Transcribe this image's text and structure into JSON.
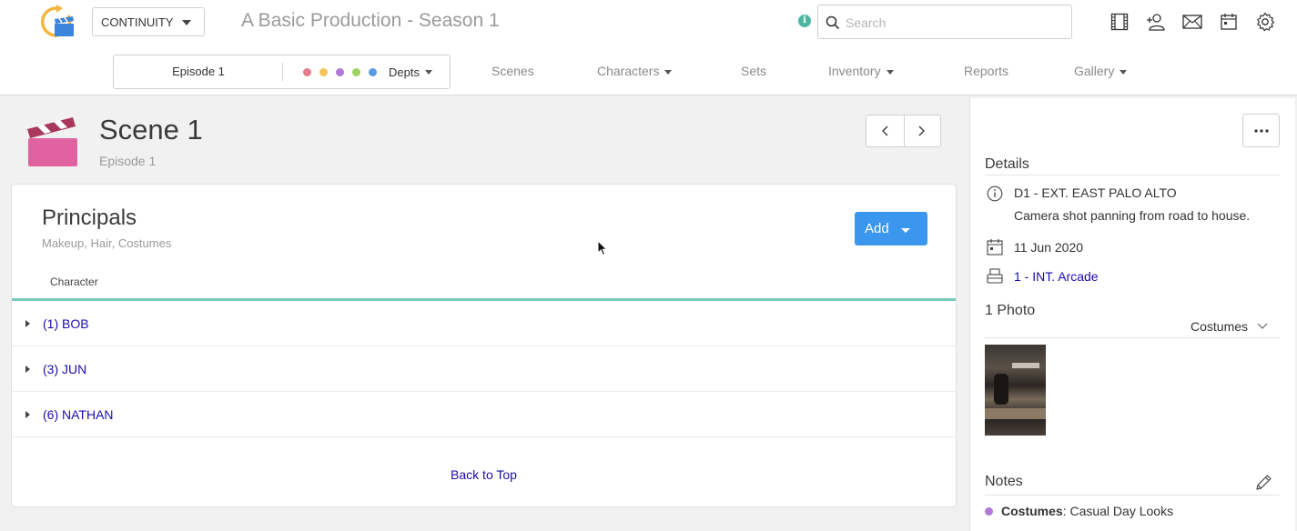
{
  "app": {
    "switcher_label": "CONTINUITY",
    "production_title": "A Basic Production - Season 1",
    "search_placeholder": "Search",
    "top_icons": [
      "film-icon",
      "add-person-icon",
      "mail-icon",
      "calendar-icon",
      "settings-icon"
    ]
  },
  "nav": {
    "episode": "Episode 1",
    "depts_label": "Depts",
    "dept_colors": [
      "#e57b8c",
      "#f2c45a",
      "#b07ad6",
      "#9fd25e",
      "#5a9be6"
    ],
    "items": [
      {
        "label": "Scenes",
        "dropdown": false
      },
      {
        "label": "Characters",
        "dropdown": true
      },
      {
        "label": "Sets",
        "dropdown": false
      },
      {
        "label": "Inventory",
        "dropdown": true
      },
      {
        "label": "Reports",
        "dropdown": false
      },
      {
        "label": "Gallery",
        "dropdown": true
      }
    ]
  },
  "scene": {
    "title": "Scene 1",
    "episode": "Episode 1"
  },
  "principals": {
    "title": "Principals",
    "subtitle": "Makeup, Hair, Costumes",
    "add_label": "Add",
    "column_header": "Character",
    "rows": [
      "(1) BOB",
      "(3) JUN",
      "(6) NATHAN"
    ],
    "back_to_top": "Back to Top"
  },
  "details": {
    "title": "Details",
    "heading": "D1 - EXT. EAST PALO ALTO",
    "description": "Camera shot panning from road to house.",
    "date": "11 Jun 2020",
    "set_link": "1 - INT. Arcade"
  },
  "photos": {
    "title": "1 Photo",
    "filter": "Costumes"
  },
  "notes": {
    "title": "Notes",
    "dept": "Costumes",
    "text": ": Casual Day Looks",
    "dept_color": "#b07ad6"
  }
}
